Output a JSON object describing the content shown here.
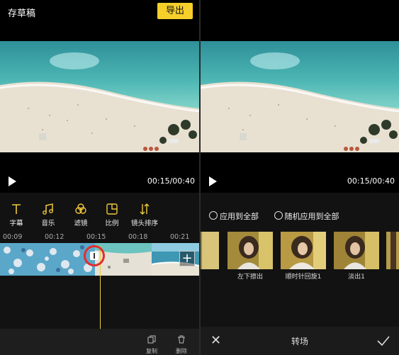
{
  "left": {
    "draft_label": "存草稿",
    "export_label": "导出",
    "timecode": "00:15/00:40",
    "tools": [
      {
        "icon": "text-icon",
        "label": "字幕"
      },
      {
        "icon": "music-icon",
        "label": "音乐"
      },
      {
        "icon": "filter-icon",
        "label": "滤镜"
      },
      {
        "icon": "ratio-icon",
        "label": "比例"
      },
      {
        "icon": "sort-icon",
        "label": "镜头排序"
      }
    ],
    "ruler": [
      "00:09",
      "00:12",
      "00:15",
      "00:18",
      "00:21"
    ],
    "add_label": "+",
    "bottom": {
      "copy_label": "复制",
      "delete_label": "删除"
    }
  },
  "right": {
    "timecode": "00:15/00:40",
    "options": {
      "apply_all": "应用到全部",
      "random_all": "随机应用到全部"
    },
    "transitions": [
      "左下擦出",
      "顺时针回旋1",
      "淡出1"
    ],
    "bottom_title": "转场"
  },
  "colors": {
    "accent": "#f6cf2a",
    "playhead": "#e8cf3c",
    "highlight_ring": "#e32d2d",
    "panel_bg": "#121212"
  }
}
